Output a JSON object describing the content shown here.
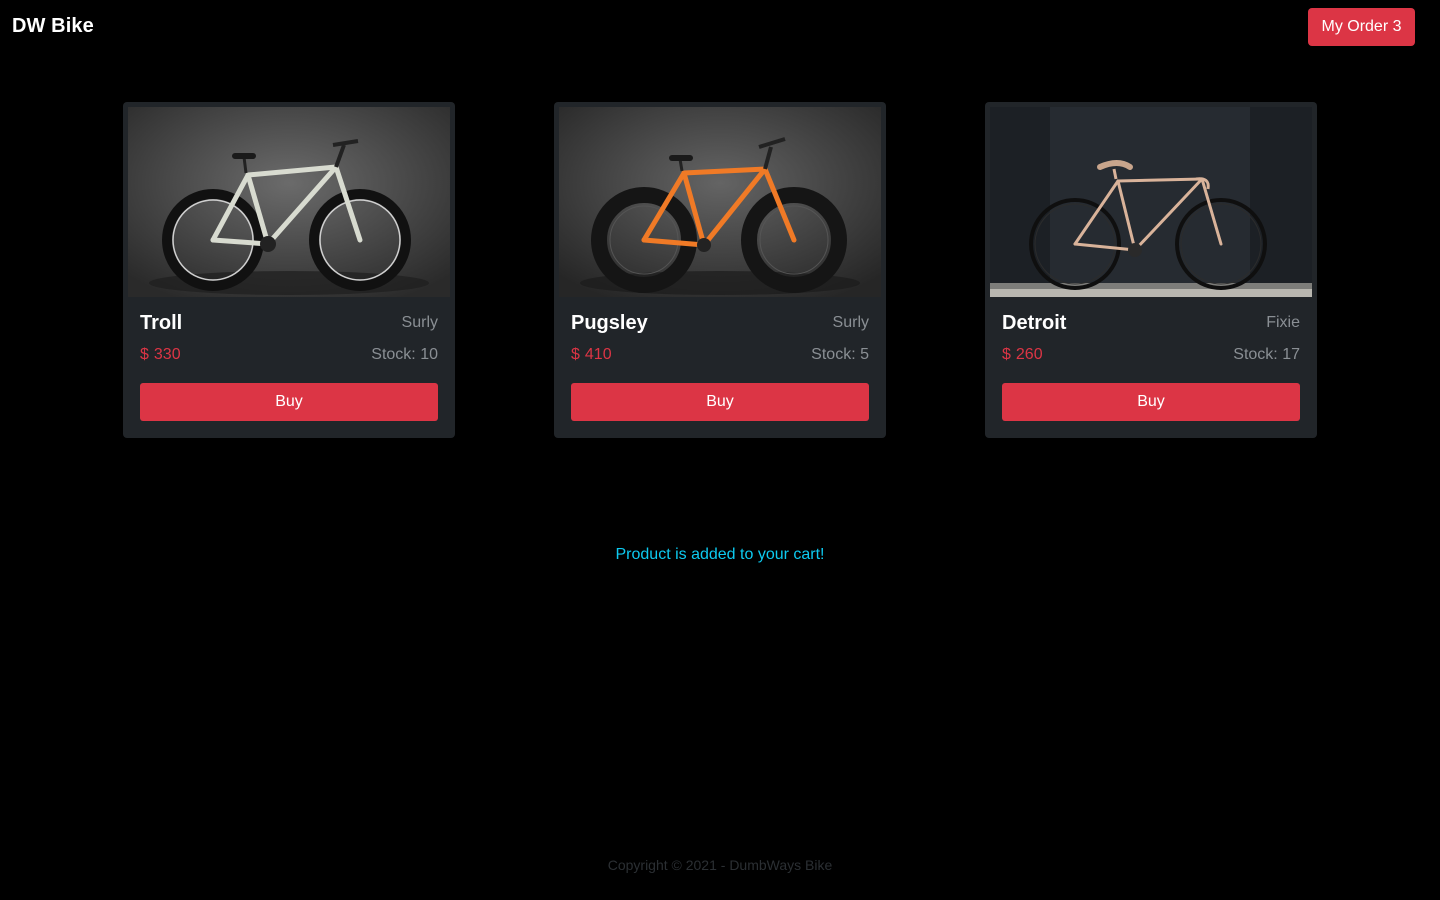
{
  "navbar": {
    "brand": "DW Bike",
    "order_button": "My Order 3"
  },
  "products": [
    {
      "name": "Troll",
      "brand": "Surly",
      "currency": "$",
      "price": "330",
      "stock_label": "Stock:",
      "stock": "10",
      "buy_label": "Buy",
      "frame_color": "#d8dbd0",
      "background_color": "#3e3e3e"
    },
    {
      "name": "Pugsley",
      "brand": "Surly",
      "currency": "$",
      "price": "410",
      "stock_label": "Stock:",
      "stock": "5",
      "buy_label": "Buy",
      "frame_color": "#f07a26",
      "background_color": "#3a3a3a"
    },
    {
      "name": "Detroit",
      "brand": "Fixie",
      "currency": "$",
      "price": "260",
      "stock_label": "Stock:",
      "stock": "17",
      "buy_label": "Buy",
      "frame_color": "#d9b39a",
      "background_color": "#262b31"
    }
  ],
  "message": "Product is added to your cart!",
  "footer": "Copyright © 2021 - DumbWays Bike",
  "colors": {
    "accent": "#dc3545",
    "info": "#0dcaf0",
    "card": "#212529",
    "background": "#000000"
  }
}
